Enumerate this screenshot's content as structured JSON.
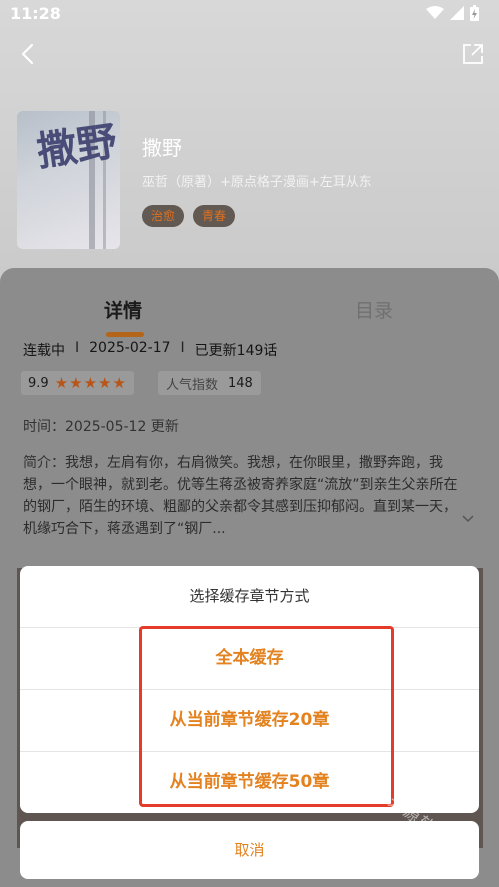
{
  "status_bar": {
    "time": "11:28"
  },
  "book": {
    "title": "撒野",
    "authors": "巫哲（原著）+原点格子漫画+左耳从东",
    "cover_text": "撒野",
    "tags": [
      "治愈",
      "青春"
    ]
  },
  "tabs": [
    {
      "label": "详情",
      "active": true
    },
    {
      "label": "目录",
      "active": false
    }
  ],
  "meta": {
    "status": "连载中",
    "date": "2025-02-17",
    "updated": "已更新149话",
    "separator": "I"
  },
  "rating": {
    "score": "9.9",
    "stars": 5,
    "stars_text": "★★★★★",
    "popularity_label": "人气指数",
    "popularity_value": "148"
  },
  "update_line": "时间：2025-05-12 更新",
  "intro": {
    "label": "简介：",
    "text": "我想，左肩有你，右肩微笑。我想，在你眼里，撒野奔跑，我想，一个眼神，就到老。优等生蒋丞被寄养家庭“流放”到亲生父亲所在的钢厂，陌生的环境、粗鄙的父亲都令其感到压抑郁闷。直到某一天，机缘巧合下，蒋丞遇到了“钢厂..."
  },
  "dialog": {
    "title": "选择缓存章节方式",
    "options": [
      "全本缓存",
      "从当前章节缓存20章",
      "从当前章节缓存50章"
    ],
    "cancel": "取消"
  },
  "watermark": "天源软件站",
  "colors": {
    "accent": "#e3821f",
    "highlight": "#e43b2b",
    "star": "#b8561a"
  }
}
